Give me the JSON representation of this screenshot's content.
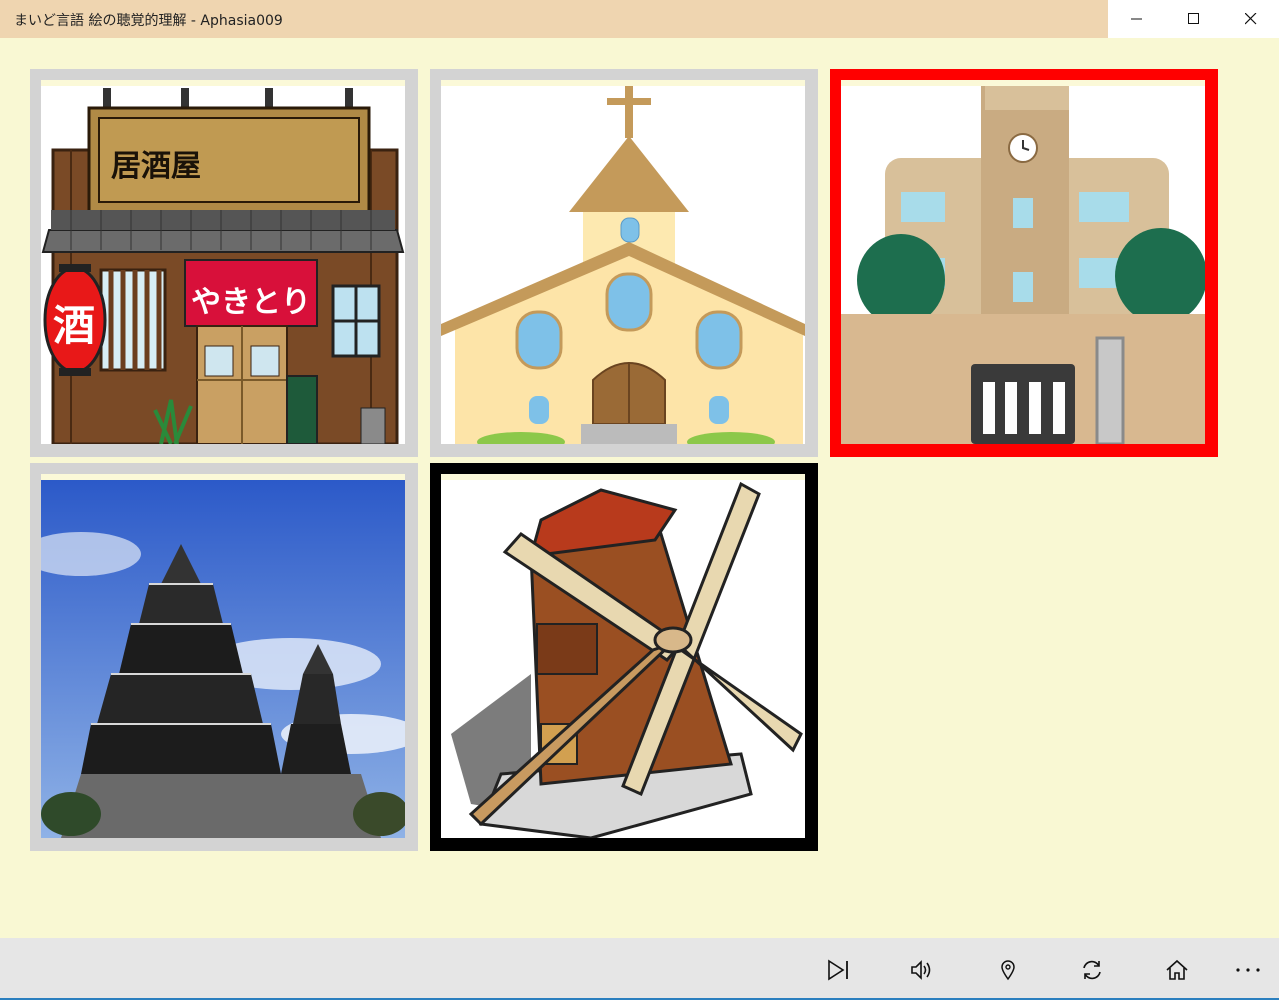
{
  "window": {
    "title": "まいど言語 絵の聴覚的理解 - Aphasia009",
    "controls": [
      "minimize",
      "maximize",
      "close"
    ]
  },
  "colors": {
    "background": "#f9f8d3",
    "title_bar": "#efd5b0",
    "tile_border_default": "#d3d3d3",
    "tile_border_selected_wrong": "#ff0000",
    "tile_border_focused": "#000000",
    "app_bar": "#e6e6e6"
  },
  "tiles": [
    {
      "subject": "izakaya",
      "state": "default",
      "labels": {
        "sign": "居酒屋",
        "lantern": "酒",
        "noren": "やきとり"
      }
    },
    {
      "subject": "church",
      "state": "default"
    },
    {
      "subject": "school",
      "state": "selected-red"
    },
    {
      "subject": "castle",
      "state": "default"
    },
    {
      "subject": "windmill",
      "state": "focused-black"
    }
  ],
  "appbar": {
    "buttons": [
      {
        "icon": "skip-next-icon"
      },
      {
        "icon": "volume-icon"
      },
      {
        "icon": "map-pin-icon"
      },
      {
        "icon": "refresh-icon"
      },
      {
        "icon": "home-icon"
      },
      {
        "icon": "more-icon"
      }
    ]
  }
}
